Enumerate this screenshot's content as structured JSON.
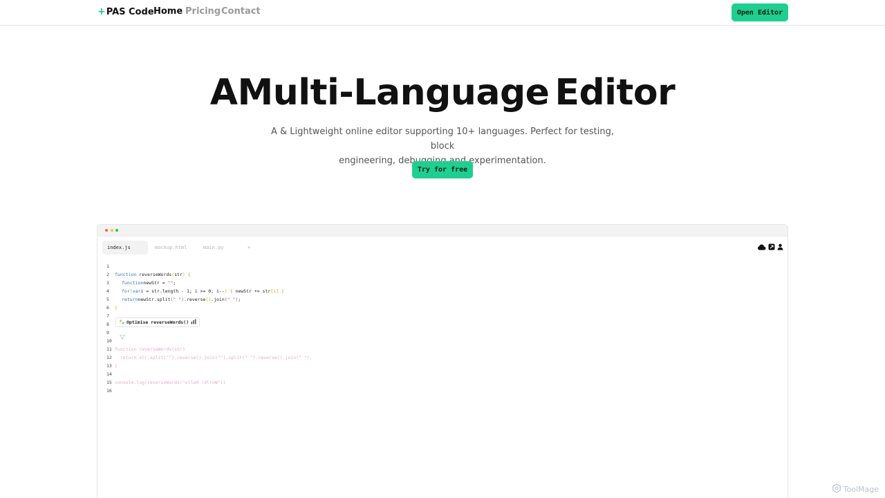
{
  "nav": {
    "brand_plus": "+",
    "brand_name": "PAS Code",
    "links": [
      {
        "label": "Home",
        "active": true
      },
      {
        "label": "Pricing",
        "active": false
      },
      {
        "label": "Contact",
        "active": false
      }
    ],
    "open_editor_label": "Open Editor"
  },
  "hero": {
    "title_part1": "AMulti-Language",
    "title_part2": "Editor",
    "subtitle_line1": "A & Lightweight online editor supporting 10+ languages. Perfect for testing, block",
    "subtitle_line2": "engineering, debugging and experimentation.",
    "cta_label": "Try for free"
  },
  "editor": {
    "window_dots": [
      "#ff5f57",
      "#febc2e",
      "#28c840"
    ],
    "tabs": [
      {
        "label": "index.js",
        "active": true
      },
      {
        "label": "mockup.html",
        "active": false
      },
      {
        "label": "main.py",
        "active": false
      },
      {
        "label": "+",
        "active": false
      }
    ],
    "toolbar_icons": [
      "cloud-icon",
      "share-icon",
      "user-icon"
    ],
    "line_numbers": [
      "1",
      "2",
      "3",
      "4",
      "5",
      "6",
      "7",
      "8",
      "9",
      "10",
      "11",
      "12",
      "13",
      "14",
      "15",
      "16"
    ],
    "code": {
      "l1_kw": "function",
      "l1_name": " reverseWords",
      "l1_paren_open": "(",
      "l1_arg": "str",
      "l1_paren_close": ")",
      "l1_brace": " {",
      "l2_kw": "function",
      "l2_rest": "newStr = ",
      "l2_str": "\"\"",
      "l2_end": ";",
      "l3_kw1": "for",
      "l3_p1": "(",
      "l3_kw2": "var",
      "l3_rest": "i = str.length - 1; i >= 0; i--",
      "l3_p2": ")",
      "l3_b1": " { ",
      "l3_body": "newStr += str",
      "l3_idx": "[i]",
      "l3_b2": " }",
      "l4_kw": "return",
      "l4_rest": "newStr.split",
      "l4_s1": "(\" \")",
      "l4_rev": ".reverse",
      "l4_p": "()",
      "l4_join": ".join",
      "l4_s2": "(\" \")",
      "l4_end": ";",
      "l5_brace": "}",
      "l10": "function reverseWords(str)",
      "l11": "  return str.split(\"\").reverse().join(\"\").split(\" \").reverse().join(\" \");",
      "l12": "}",
      "l14": "console.log(reverseWords(\"olleH !dlroW\"))"
    },
    "suggestion_label": "Optimise reverseWords()"
  },
  "watermark": "ToolMage",
  "colors": {
    "accent": "#1fcf8f",
    "keyword": "#2a6fc9",
    "string": "#c2416c",
    "ghost_code": "#e7a8c9",
    "bracket": "#d4a017"
  }
}
